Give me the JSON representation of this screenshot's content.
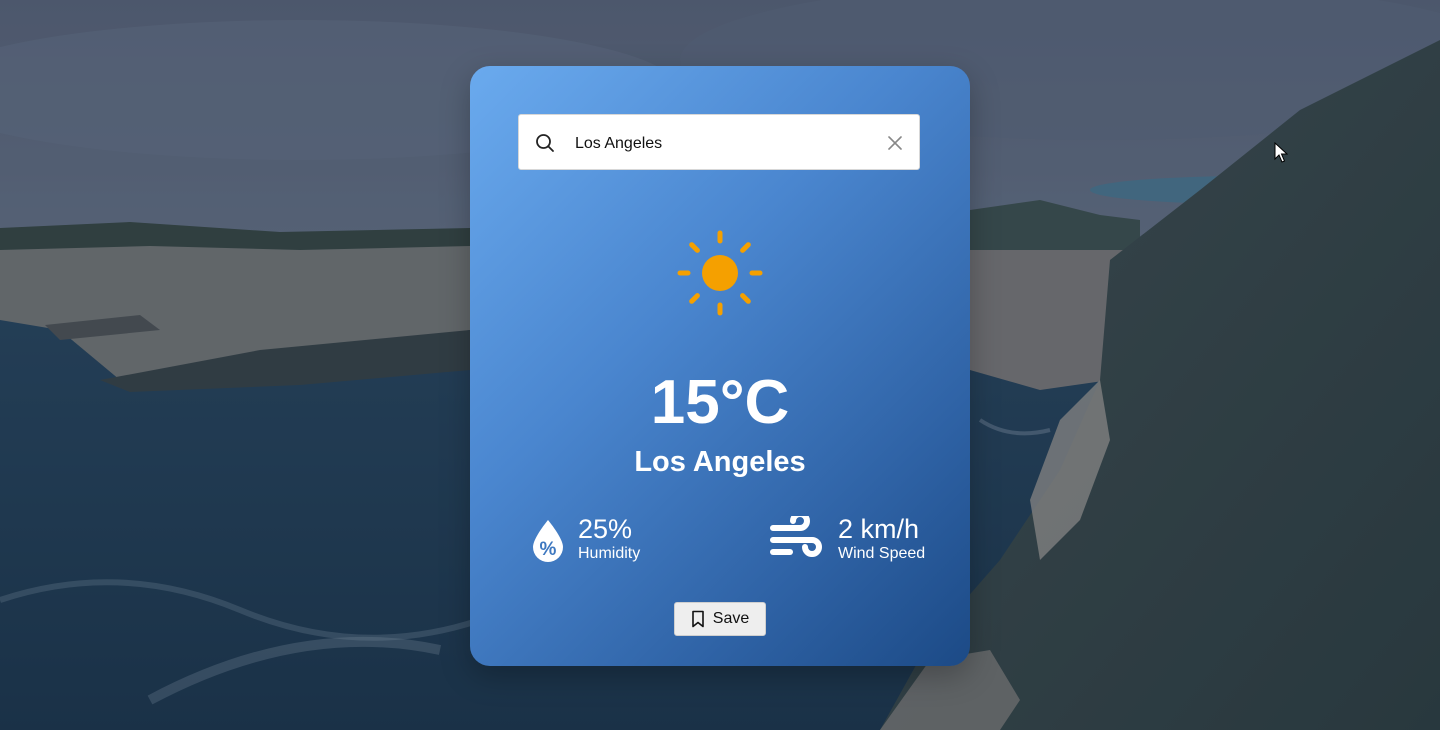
{
  "search": {
    "value": "Los Angeles",
    "icon": "search-icon",
    "clear_icon": "close-icon"
  },
  "weather": {
    "icon": "sun-icon",
    "temperature": "15°C",
    "city": "Los Angeles"
  },
  "humidity": {
    "value": "25%",
    "label": "Humidity",
    "icon": "humidity-icon"
  },
  "wind": {
    "value": "2 km/h",
    "label": "Wind Speed",
    "icon": "wind-icon"
  },
  "save": {
    "label": "Save",
    "icon": "bookmark-icon"
  },
  "colors": {
    "card_gradient_start": "#6aaaee",
    "card_gradient_end": "#1c4a86",
    "sun": "#f5a000",
    "text": "#ffffff"
  }
}
